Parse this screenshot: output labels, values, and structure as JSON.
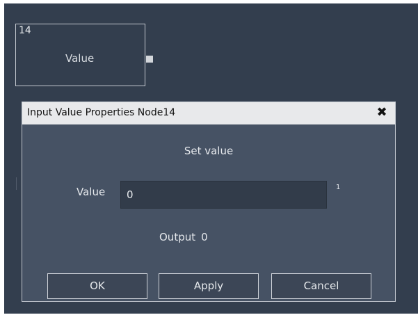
{
  "node": {
    "id": "14",
    "title": "Value"
  },
  "dialog": {
    "title": "Input Value Properties Node14",
    "close_glyph": "✖",
    "heading": "Set value",
    "value_label": "Value",
    "value_input": "0",
    "value_side": "1",
    "output_label": "Output",
    "output_value": "0",
    "buttons": {
      "ok": "OK",
      "apply": "Apply",
      "cancel": "Cancel"
    }
  },
  "colors": {
    "canvas": "#333e4e",
    "dialog_body": "#465264",
    "titlebar": "#e8e9eb"
  }
}
